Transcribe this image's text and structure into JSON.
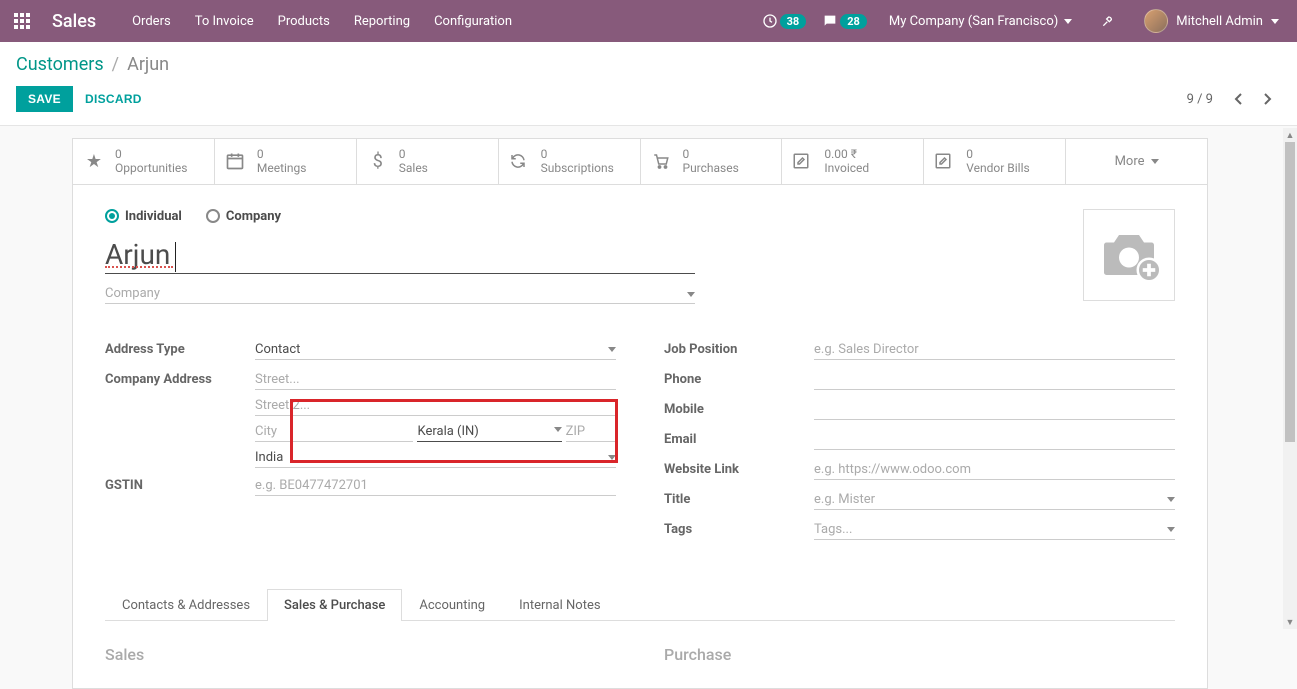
{
  "navbar": {
    "brand": "Sales",
    "menu": [
      "Orders",
      "To Invoice",
      "Products",
      "Reporting",
      "Configuration"
    ],
    "activity_count": "38",
    "messages_count": "28",
    "company": "My Company (San Francisco)",
    "user": "Mitchell Admin"
  },
  "breadcrumb": {
    "root": "Customers",
    "current": "Arjun"
  },
  "actions": {
    "save": "SAVE",
    "discard": "DISCARD",
    "pager": "9 / 9"
  },
  "stats": {
    "opportunities": {
      "val": "0",
      "lbl": "Opportunities"
    },
    "meetings": {
      "val": "0",
      "lbl": "Meetings"
    },
    "sales": {
      "val": "0",
      "lbl": "Sales"
    },
    "subscriptions": {
      "val": "0",
      "lbl": "Subscriptions"
    },
    "purchases": {
      "val": "0",
      "lbl": "Purchases"
    },
    "invoiced": {
      "val": "0.00 ₹",
      "lbl": "Invoiced"
    },
    "vendor": {
      "val": "0",
      "lbl": "Vendor Bills"
    },
    "more": "More"
  },
  "form": {
    "type_individual": "Individual",
    "type_company": "Company",
    "name": "Arjun",
    "company_placeholder": "Company",
    "labels": {
      "address_type": "Address Type",
      "company_address": "Company Address",
      "gstin": "GSTIN",
      "job_position": "Job Position",
      "phone": "Phone",
      "mobile": "Mobile",
      "email": "Email",
      "website": "Website Link",
      "title": "Title",
      "tags": "Tags"
    },
    "values": {
      "address_type": "Contact",
      "state": "Kerala (IN)",
      "country": "India"
    },
    "placeholders": {
      "street": "Street...",
      "street2": "Street 2...",
      "city": "City",
      "zip": "ZIP",
      "gstin": "e.g. BE0477472701",
      "job": "e.g. Sales Director",
      "website": "e.g. https://www.odoo.com",
      "title": "e.g. Mister",
      "tags": "Tags..."
    }
  },
  "tabs": {
    "contacts": "Contacts & Addresses",
    "sales": "Sales & Purchase",
    "accounting": "Accounting",
    "notes": "Internal Notes"
  },
  "sections": {
    "sales": "Sales",
    "purchase": "Purchase"
  }
}
